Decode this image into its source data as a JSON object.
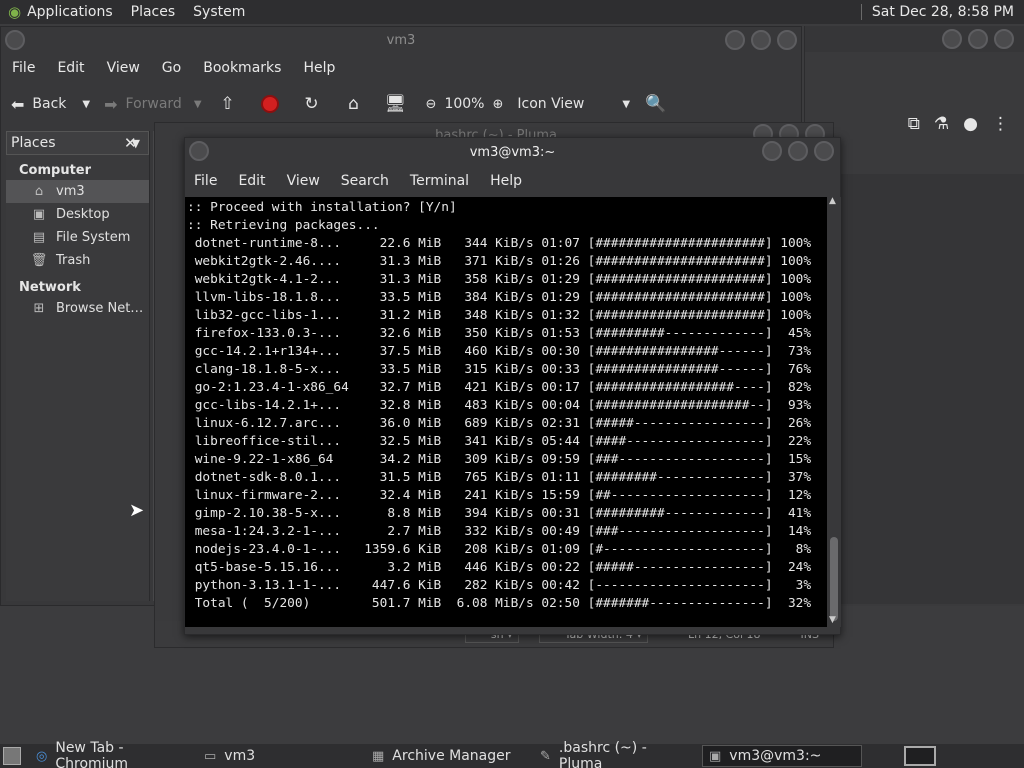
{
  "top_panel": {
    "menus": [
      "Applications",
      "Places",
      "System"
    ],
    "clock": "Sat Dec 28,  8:58 PM"
  },
  "file_manager": {
    "title": "vm3",
    "menu": [
      "File",
      "Edit",
      "View",
      "Go",
      "Bookmarks",
      "Help"
    ],
    "toolbar": {
      "back": "Back",
      "forward": "Forward",
      "zoom": "100%",
      "view_mode": "Icon View"
    },
    "sidebar": {
      "header": "Places",
      "sections": [
        {
          "title": "Computer",
          "items": [
            {
              "label": "vm3",
              "icon": "home-icon"
            },
            {
              "label": "Desktop",
              "icon": "desktop-icon"
            },
            {
              "label": "File System",
              "icon": "drive-icon"
            },
            {
              "label": "Trash",
              "icon": "trash-icon"
            }
          ]
        },
        {
          "title": "Network",
          "items": [
            {
              "label": "Browse Net…",
              "icon": "network-icon"
            }
          ]
        }
      ]
    }
  },
  "pluma": {
    "title": ".bashrc (~) - Pluma",
    "status": {
      "lang": "sh",
      "tab_width": "Tab Width:  4",
      "position": "Ln 12, Col 18",
      "mode": "INS"
    }
  },
  "terminal": {
    "title": "vm3@vm3:~",
    "menu": [
      "File",
      "Edit",
      "View",
      "Search",
      "Terminal",
      "Help"
    ],
    "lines": [
      ":: Proceed with installation? [Y/n]",
      ":: Retrieving packages...",
      " dotnet-runtime-8...     22.6 MiB   344 KiB/s 01:07 [######################] 100%",
      " webkit2gtk-2.46....     31.3 MiB   371 KiB/s 01:26 [######################] 100%",
      " webkit2gtk-4.1-2...     31.3 MiB   358 KiB/s 01:29 [######################] 100%",
      " llvm-libs-18.1.8...     33.5 MiB   384 KiB/s 01:29 [######################] 100%",
      " lib32-gcc-libs-1...     31.2 MiB   348 KiB/s 01:32 [######################] 100%",
      " firefox-133.0.3-...     32.6 MiB   350 KiB/s 01:53 [#########-------------]  45%",
      " gcc-14.2.1+r134+...     37.5 MiB   460 KiB/s 00:30 [################------]  73%",
      " clang-18.1.8-5-x...     33.5 MiB   315 KiB/s 00:33 [################------]  76%",
      " go-2:1.23.4-1-x86_64    32.7 MiB   421 KiB/s 00:17 [##################----]  82%",
      " gcc-libs-14.2.1+...     32.8 MiB   483 KiB/s 00:04 [####################--]  93%",
      " linux-6.12.7.arc...     36.0 MiB   689 KiB/s 02:31 [#####-----------------]  26%",
      " libreoffice-stil...     32.5 MiB   341 KiB/s 05:44 [####------------------]  22%",
      " wine-9.22-1-x86_64      34.2 MiB   309 KiB/s 09:59 [###-------------------]  15%",
      " dotnet-sdk-8.0.1...     31.5 MiB   765 KiB/s 01:11 [########--------------]  37%",
      " linux-firmware-2...     32.4 MiB   241 KiB/s 15:59 [##--------------------]  12%",
      " gimp-2.10.38-5-x...      8.8 MiB   394 KiB/s 00:31 [#########-------------]  41%",
      " mesa-1:24.3.2-1-...      2.7 MiB   332 KiB/s 00:49 [###-------------------]  14%",
      " nodejs-23.4.0-1-...   1359.6 KiB   208 KiB/s 01:09 [#---------------------]   8%",
      " qt5-base-5.15.16...      3.2 MiB   446 KiB/s 00:22 [#####-----------------]  24%",
      " python-3.13.1-1-...    447.6 KiB   282 KiB/s 00:42 [----------------------]   3%",
      " Total (  5/200)        501.7 MiB  6.08 MiB/s 02:50 [#######---------------]  32%"
    ]
  },
  "chromium": {
    "title_blank": ""
  },
  "taskbar": {
    "tasks": [
      {
        "label": "New Tab - Chromium",
        "icon": "chromium-icon"
      },
      {
        "label": "vm3",
        "icon": "folder-icon"
      },
      {
        "label": "Archive Manager",
        "icon": "archive-icon"
      },
      {
        "label": ".bashrc (~) - Pluma",
        "icon": "text-editor-icon"
      },
      {
        "label": "vm3@vm3:~",
        "icon": "terminal-icon"
      }
    ]
  }
}
